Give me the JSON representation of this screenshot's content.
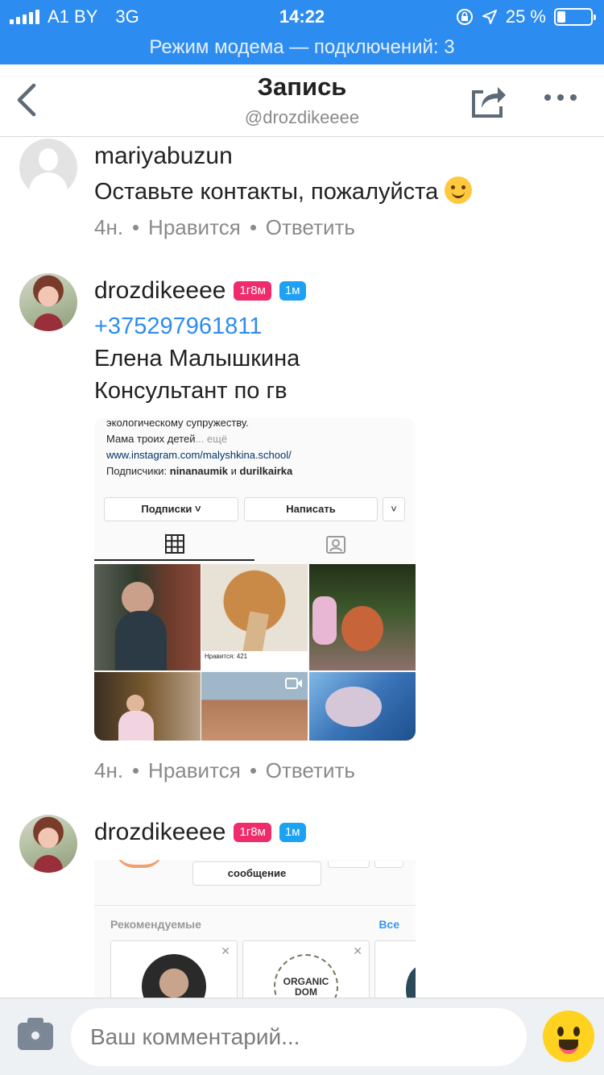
{
  "status_bar": {
    "carrier": "A1 BY",
    "network": "3G",
    "time": "14:22",
    "battery": "25 %",
    "battery_level": 0.25,
    "hotspot_banner": "Режим модема — подключений: 3"
  },
  "nav": {
    "title": "Запись",
    "subtitle": "@drozdikeeee"
  },
  "comments": [
    {
      "author": "mariyabuzun",
      "text": "Оставьте контакты, пожалуйста",
      "time": "4н.",
      "like_label": "Нравится",
      "reply_label": "Ответить"
    },
    {
      "author": "drozdikeeee",
      "badge_age": "1г8м",
      "badge_time": "1м",
      "phone": "+375297961811",
      "line1": "Елена Малышкина",
      "line2": "Консультант по гв",
      "time": "4н.",
      "like_label": "Нравится",
      "reply_label": "Ответить",
      "attachment": {
        "bio_line1": "экологическому супружеству.",
        "bio_line2": "Мама троих детей",
        "bio_more": "... ещё",
        "bio_link": "www.instagram.com/malyshkina.school/",
        "followers_prefix": "Подписчики: ",
        "follower1": "ninanaumik",
        "followers_and": " и ",
        "follower2": "durilkairka",
        "btn_following": "Подписки ˅",
        "btn_message": "Написать",
        "post_likes": "Нравится: 421"
      }
    },
    {
      "author": "drozdikeeee",
      "badge_age": "1г8м",
      "badge_time": "1м",
      "attachment": {
        "btn_message": "сообщение",
        "recommended_label": "Рекомендуемые",
        "see_all": "Все",
        "brand_line1": "ORGANIC",
        "brand_line2": "DOM"
      }
    }
  ],
  "input": {
    "placeholder": "Ваш комментарий..."
  },
  "colors": {
    "accent": "#2d8cf0",
    "badge_pink": "#f02b6b",
    "badge_blue": "#1da1f2",
    "muted": "#8a8a8a"
  },
  "icons": [
    "signal-icon",
    "lock-rotation-icon",
    "location-arrow-icon",
    "battery-icon",
    "back-chevron-icon",
    "share-icon",
    "more-icon",
    "grid-icon",
    "tagged-icon",
    "camera-icon",
    "emoji-icon"
  ]
}
